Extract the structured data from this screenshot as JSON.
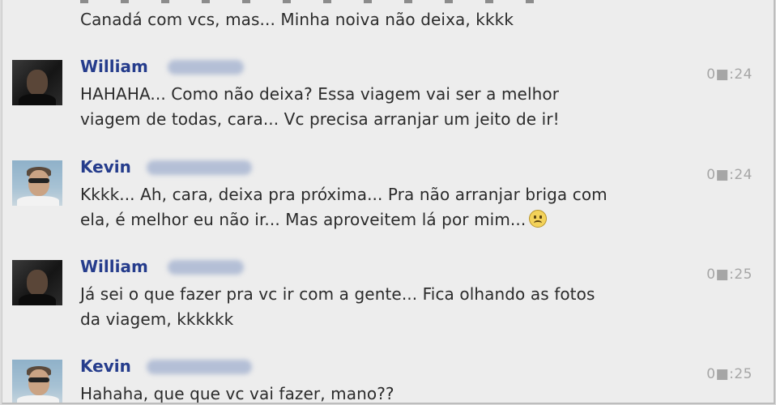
{
  "messages": [
    {
      "sender": "",
      "time": "",
      "lines": [
        "Canadá com vcs, mas... Minha noiva não deixa, kkkk"
      ]
    },
    {
      "sender": "William",
      "time": "0■:24",
      "lines": [
        "HAHAHA... Como não deixa? Essa viagem vai ser a melhor",
        "viagem de todas, cara... Vc precisa arranjar um jeito de ir!"
      ]
    },
    {
      "sender": "Kevin",
      "time": "0■:24",
      "lines": [
        "Kkkk... Ah, cara, deixa pra próxima... Pra não arranjar briga com",
        "ela, é melhor eu não ir... Mas aproveitem lá por mim..."
      ],
      "emoticon": "sad-face-icon"
    },
    {
      "sender": "William",
      "time": "0■:25",
      "lines": [
        "Já sei o que fazer pra vc ir com a gente... Fica olhando as fotos",
        "da viagem, kkkkkk"
      ]
    },
    {
      "sender": "Kevin",
      "time": "0■:25",
      "lines": [
        "Hahaha, que que vc vai fazer, mano??"
      ]
    }
  ],
  "colors": {
    "background": "#ededed",
    "sender_name": "#253c8c",
    "message_text": "#2b2b2b",
    "timestamp": "#a6a6a6"
  }
}
